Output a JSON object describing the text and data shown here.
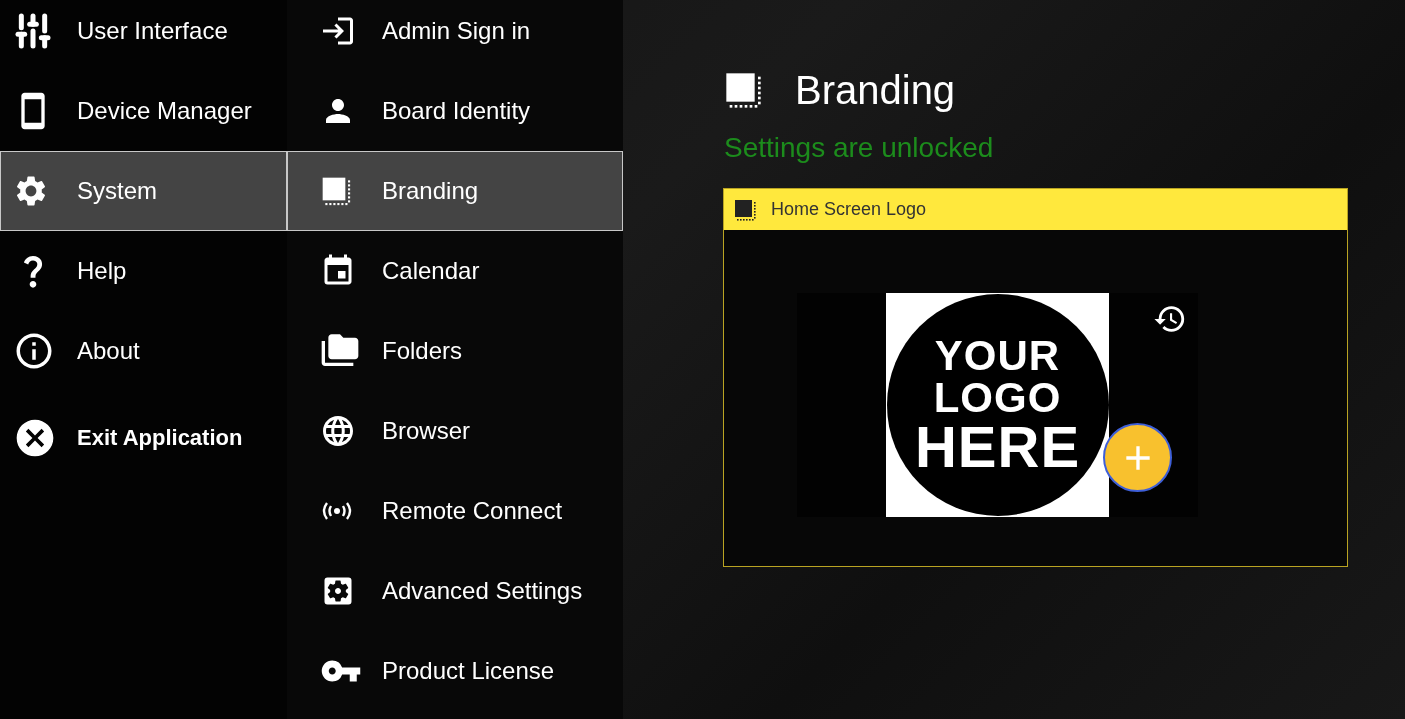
{
  "main_menu": [
    {
      "label": "User Interface",
      "kind": "page",
      "selected": false
    },
    {
      "label": "Device Manager",
      "kind": "page",
      "selected": false
    },
    {
      "label": "System",
      "kind": "page",
      "selected": true
    },
    {
      "label": "Help",
      "kind": "page",
      "selected": false
    },
    {
      "label": "About",
      "kind": "page",
      "selected": false
    },
    {
      "label": "Exit Application",
      "kind": "action",
      "selected": false
    }
  ],
  "sub_menu": [
    {
      "label": "Admin Sign in",
      "selected": false
    },
    {
      "label": "Board Identity",
      "selected": false
    },
    {
      "label": "Branding",
      "selected": true
    },
    {
      "label": "Calendar",
      "selected": false
    },
    {
      "label": "Folders",
      "selected": false
    },
    {
      "label": "Browser",
      "selected": false
    },
    {
      "label": "Remote Connect",
      "selected": false
    },
    {
      "label": "Advanced Settings",
      "selected": false
    },
    {
      "label": "Product License",
      "selected": false
    }
  ],
  "page": {
    "title": "Branding",
    "status": "Settings are unlocked",
    "panels": [
      {
        "title": "Home Screen Logo",
        "logo_lines": [
          "YOUR",
          "LOGO",
          "HERE"
        ]
      }
    ]
  }
}
